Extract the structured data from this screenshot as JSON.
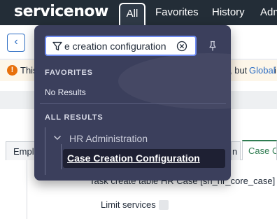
{
  "header": {
    "logo_text": "servicenow",
    "nav": {
      "all": "All",
      "favorites": "Favorites",
      "history": "History",
      "admin_partial": "Adm"
    }
  },
  "page": {
    "back_icon": "chevron-left-icon",
    "warning": {
      "icon": "exclamation-icon",
      "lead": "This",
      "mid": ", but",
      "global_link": "Global",
      "tail": "i"
    },
    "tabs": [
      "Emplo",
      "n",
      "Case Cr"
    ],
    "task_create_table_row": "Task create table   HR Case [sn_hr_core_case]",
    "limit_services_label": "Limit services"
  },
  "search_panel": {
    "query": "e creation configuration",
    "filter_icon": "filter-icon",
    "clear_icon": "clear-circle-icon",
    "pin_icon": "pin-icon",
    "favorites_heading": "FAVORITES",
    "favorites_empty": "No Results",
    "all_results_heading": "ALL RESULTS",
    "group": {
      "label": "HR Administration",
      "expanded": true,
      "items": [
        "Case Creation Configuration"
      ]
    }
  },
  "colors": {
    "topbar": "#232d37",
    "panel": "#3b3f5c",
    "search_border": "#6f8cf2",
    "selected_item_bg": "#1e2033",
    "warning_icon": "#e8700b",
    "link_blue": "#2f6fc4",
    "active_tab_green": "#2f7c51"
  }
}
